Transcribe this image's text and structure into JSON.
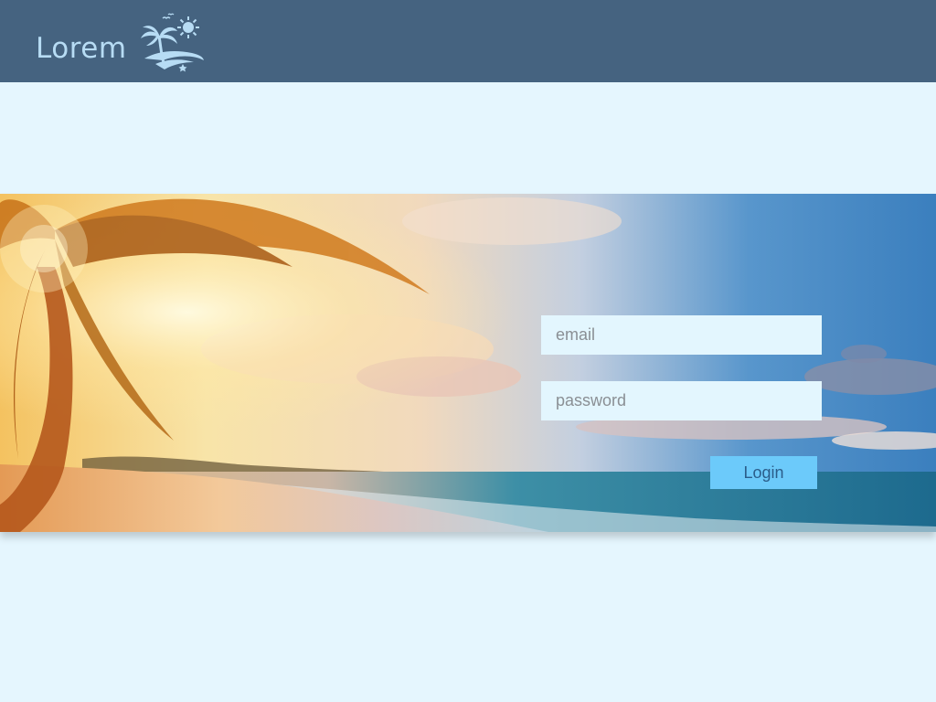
{
  "header": {
    "logo_text": "Lorem",
    "logo_icon": "palm-tree-sun-logo-icon",
    "background_color": "#456380"
  },
  "hero": {
    "image": "tropical-beach-sunset-palm-photo"
  },
  "login_form": {
    "email_placeholder": "email",
    "password_placeholder": "password",
    "submit_label": "Login",
    "button_color": "#6ccafa"
  },
  "colors": {
    "page_background": "#e5f6fe",
    "field_background": "#e3f6fe"
  }
}
